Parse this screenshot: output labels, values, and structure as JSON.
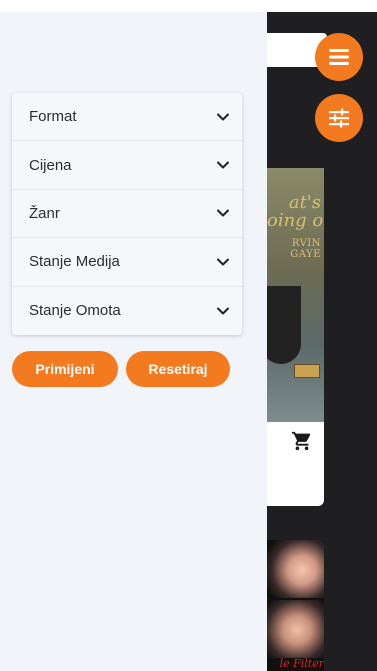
{
  "filters": {
    "items": [
      {
        "label": "Format"
      },
      {
        "label": "Cijena"
      },
      {
        "label": "Žanr"
      },
      {
        "label": "Stanje Medija"
      },
      {
        "label": "Stanje Omota"
      }
    ],
    "apply_label": "Primijeni",
    "reset_label": "Resetiraj"
  },
  "product": {
    "cover_title": "at's\noing on",
    "cover_artist": "RVIN GAYE"
  },
  "product2": {
    "caption": "le Filter"
  },
  "icons": {
    "menu": "menu-icon",
    "filter": "sliders-icon",
    "chevron": "chevron-down-icon",
    "cart": "cart-icon"
  },
  "colors": {
    "accent": "#f47a20",
    "drawer_bg": "#f1f4f8",
    "page_dark": "#1f1f22"
  }
}
